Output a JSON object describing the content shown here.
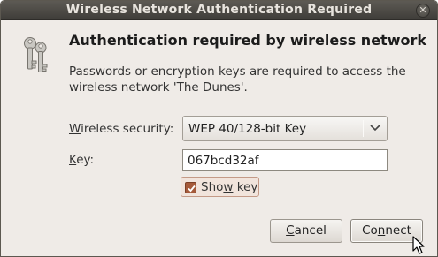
{
  "window": {
    "title": "Wireless Network Authentication Required",
    "close_icon": "close-icon"
  },
  "icon": "keys-icon",
  "heading": "Authentication required by wireless network",
  "description": "Passwords or encryption keys are required to access the wireless network 'The Dunes'.",
  "security": {
    "label_mnemonic": "W",
    "label_rest": "ireless security:",
    "selected": "WEP 40/128-bit Key"
  },
  "key": {
    "label_mnemonic": "K",
    "label_rest": "ey:",
    "value": "067bcd32af"
  },
  "show_key": {
    "checked": true,
    "label_before": "Sho",
    "label_mnemonic": "w",
    "label_after": " key"
  },
  "buttons": {
    "cancel_mnemonic": "C",
    "cancel_rest": "ancel",
    "connect_before": "Co",
    "connect_mnemonic": "n",
    "connect_after": "nect"
  },
  "colors": {
    "window_bg": "#efebe7",
    "titlebar": "#3f3d39",
    "accent": "#a55a3a"
  }
}
